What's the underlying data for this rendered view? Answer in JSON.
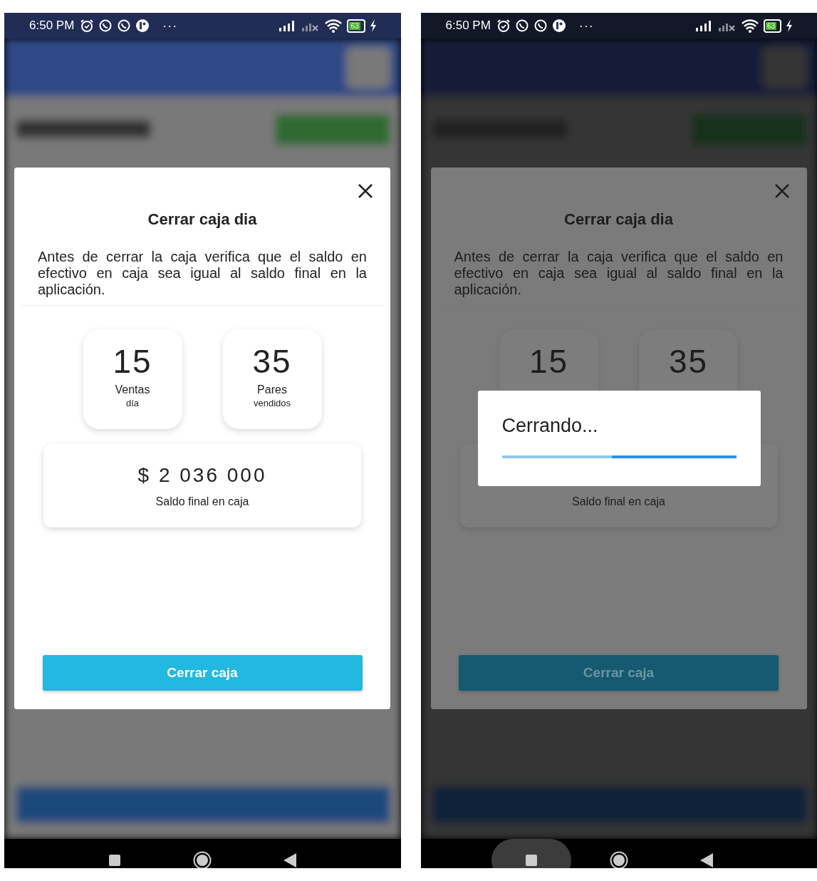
{
  "phones": [
    {
      "status_bar": {
        "time": "6:50 PM",
        "more": "···",
        "battery": "63"
      },
      "dimmed": false,
      "dialog": {
        "title": "Cerrar caja dia",
        "message": "Antes de cerrar la caja verifica que el saldo en efectivo en caja sea igual al saldo final en la aplicación.",
        "stats": [
          {
            "value": "15",
            "label": "Ventas",
            "sublabel": "día"
          },
          {
            "value": "35",
            "label": "Pares",
            "sublabel": "vendidos"
          }
        ],
        "balance": {
          "amount": "$ 2 036 000",
          "label": "Saldo final en caja"
        },
        "button": "Cerrar caja"
      },
      "nav": {
        "recents_pressed": false
      }
    },
    {
      "status_bar": {
        "time": "6:50 PM",
        "more": "···",
        "battery": "63"
      },
      "dimmed": true,
      "dialog": {
        "title": "Cerrar caja dia",
        "message": "Antes de cerrar la caja verifica que el saldo en efectivo en caja sea igual al saldo final en la aplicación.",
        "stats": [
          {
            "value": "15"
          },
          {
            "value": "35"
          }
        ],
        "balance": {
          "label": "Saldo final en caja"
        },
        "button": "Cerrar caja"
      },
      "loading": {
        "text": "Cerrando...",
        "level": 0.53
      },
      "nav": {
        "recents_pressed": true
      }
    }
  ]
}
